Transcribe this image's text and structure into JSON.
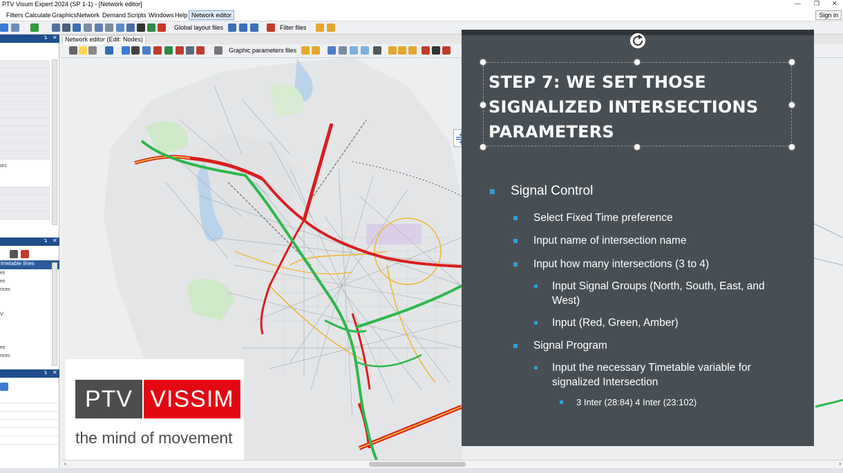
{
  "window": {
    "title": "PTV Visum Expert 2024 (SP 1-1) - [Network editor]",
    "sign_in": "Sign in"
  },
  "menu": {
    "items": [
      "Filters",
      "Calculate",
      "Graphics",
      "Network",
      "Demand",
      "Scripts",
      "Windows",
      "Help"
    ],
    "active": "Network editor"
  },
  "toolbar": {
    "global_layout": "Global layout files",
    "filter_files": "Filter files"
  },
  "left_panel": {
    "label_a": "ors",
    "timetable_tab": "imetable lines",
    "list_items": [
      "es",
      "es",
      "rices",
      "V",
      "es",
      "rices"
    ]
  },
  "editor": {
    "tab_label": "Network editor (Edit: Nodes)",
    "graphic_params": "Graphic parameters files"
  },
  "logo": {
    "left": "PTV",
    "right": "VISSIM",
    "tagline": "the mind of movement"
  },
  "slide": {
    "title": "STEP 7: WE SET THOSE SIGNALIZED INTERSECTIONS PARAMETERS",
    "bullets": {
      "signal_control": "Signal Control",
      "fixed_time": "Select Fixed Time preference",
      "intersection_name": "Input name of intersection name",
      "how_many": "Input how many intersections (3 to 4)",
      "signal_groups": "Input Signal Groups (North, South, East, and West)",
      "colors": "Input (Red, Green, Amber)",
      "signal_program": "Signal Program",
      "timetable_var": "Input the necessary Timetable variable for signalized Intersection",
      "inter_values": "3 Inter (28:84) 4 Inter (23:102)"
    }
  },
  "colors": {
    "slide_bg": "#484f54",
    "bullet_accent": "#2fa0d8",
    "logo_red": "#e30613",
    "logo_gray": "#4d4d4d",
    "road_red": "#d81e1e",
    "road_green": "#2db84b",
    "road_yellow": "#f2b632"
  }
}
